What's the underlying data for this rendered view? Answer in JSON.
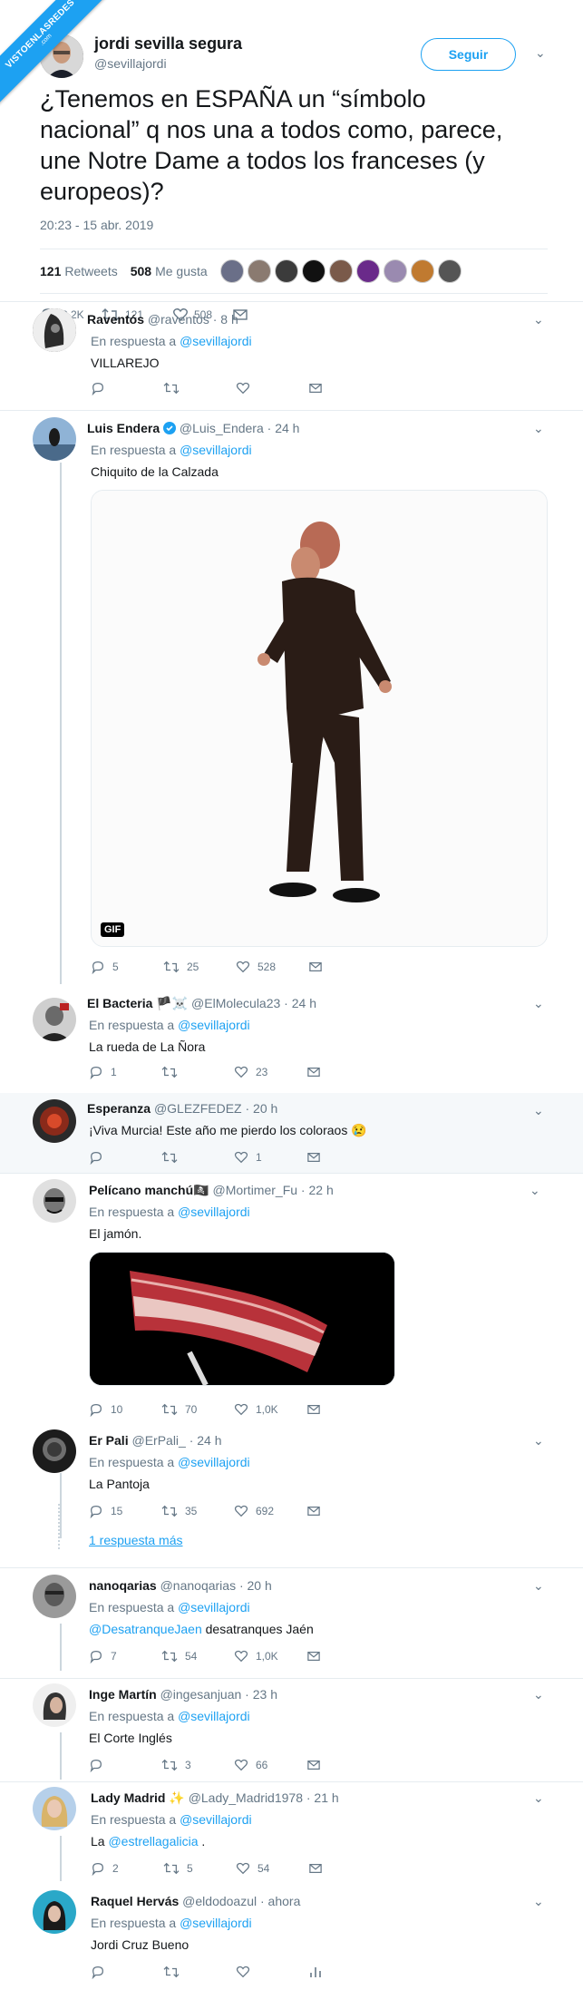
{
  "watermark": {
    "line1": "VISTOENLASREDES",
    "line2": ".com"
  },
  "main_tweet": {
    "author_name": "jordi sevilla segura",
    "author_handle": "@sevillajordi",
    "follow_label": "Seguir",
    "text": "¿Tenemos en ESPAÑA un “símbolo nacional” q nos una a todos como, parece, une Notre Dame a todos los franceses (y europeos)?",
    "date": "20:23 - 15 abr. 2019",
    "retweets_count": "121",
    "retweets_label": "Retweets",
    "likes_count": "508",
    "likes_label": "Me gusta",
    "replies": "2,2K",
    "rts": "121",
    "likes": "508",
    "liker_face_colors": [
      "#6a6f88",
      "#8a7a70",
      "#3b3b3b",
      "#111111",
      "#7a5a4a",
      "#6a2a8a",
      "#9a8ab0",
      "#c07a30",
      "#555555"
    ]
  },
  "replies": [
    {
      "name": "Raventós",
      "handle": "@raventos · 8 h",
      "replying_prefix": "En respuesta a",
      "replying_to": "@sevillajordi",
      "text": "VILLAREJO",
      "rep": "",
      "rt": "",
      "like": ""
    },
    {
      "name": "Luis Endera",
      "handle": "@Luis_Endera · 24 h",
      "replying_prefix": "En respuesta a",
      "replying_to": "@sevillajordi",
      "text": "Chiquito de la Calzada",
      "gif_label": "GIF",
      "rep": "5",
      "rt": "25",
      "like": "528"
    },
    {
      "name": "El Bacteria",
      "name_emoji": "🏴☠️",
      "handle": "@ElMolecula23 · 24 h",
      "replying_prefix": "En respuesta a",
      "replying_to": "@sevillajordi",
      "text": "La rueda de La Ñora",
      "rep": "1",
      "rt": "",
      "like": "23"
    },
    {
      "name": "Esperanza",
      "handle": "@GLEZFEDEZ · 20 h",
      "text": "¡Viva Murcia! Este año me pierdo los coloraos 😢",
      "rep": "",
      "rt": "",
      "like": "1"
    },
    {
      "name": "Pelícano manchú",
      "name_emoji": "🏴‍☠️",
      "handle": "@Mortimer_Fu · 22 h",
      "replying_prefix": "En respuesta a",
      "replying_to": "@sevillajordi",
      "text": "El jamón.",
      "rep": "10",
      "rt": "70",
      "like": "1,0K"
    },
    {
      "name": "Er Pali",
      "handle": "@ErPali_ · 24 h",
      "replying_prefix": "En respuesta a",
      "replying_to": "@sevillajordi",
      "text": "La Pantoja",
      "rep": "15",
      "rt": "35",
      "like": "692",
      "more": "1 respuesta más"
    },
    {
      "name": "nanoqarias",
      "handle": "@nanoqarias · 20 h",
      "replying_prefix": "En respuesta a",
      "replying_to": "@sevillajordi",
      "text_link": "@DesatranqueJaen",
      "text": " desatranques Jaén",
      "rep": "7",
      "rt": "54",
      "like": "1,0K"
    },
    {
      "name": "Inge Martín",
      "handle": "@ingesanjuan · 23 h",
      "replying_prefix": "En respuesta a",
      "replying_to": "@sevillajordi",
      "text": "El Corte Inglés",
      "rep": "",
      "rt": "3",
      "like": "66"
    },
    {
      "name": "Lady Madrid",
      "name_emoji": "✨",
      "handle": "@Lady_Madrid1978 · 21 h",
      "replying_prefix": "En respuesta a",
      "replying_to": "@sevillajordi",
      "text_pre": "La ",
      "text_link": "@estrellagalicia",
      "text": " .",
      "rep": "2",
      "rt": "5",
      "like": "54"
    },
    {
      "name": "Raquel Hervás",
      "handle": "@eldodoazul · ahora",
      "replying_prefix": "En respuesta a",
      "replying_to": "@sevillajordi",
      "text": "Jordi Cruz Bueno",
      "rep": "",
      "rt": "",
      "like": ""
    }
  ],
  "colors": {
    "accent": "#1da1f2",
    "muted": "#657786",
    "verified": "#1da1f2"
  }
}
